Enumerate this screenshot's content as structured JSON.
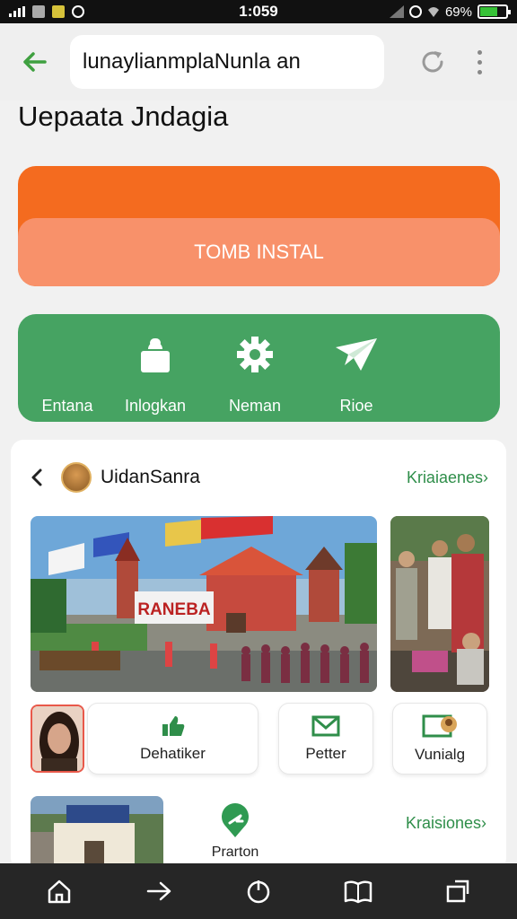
{
  "status_bar": {
    "time": "1:059",
    "battery_text": "69%"
  },
  "browser": {
    "url": "lunaylianmplaNunla an"
  },
  "page": {
    "title": "Uepaata Jndagia",
    "install_button": "TOMB INSTAL",
    "nav_items": [
      {
        "label": "Entana",
        "icon": "home-lock-icon"
      },
      {
        "label": "Inlogkan",
        "icon": "gear-icon"
      },
      {
        "label": "Neman",
        "icon": "gear-icon"
      },
      {
        "label": "Rioe",
        "icon": "send-star-icon"
      }
    ]
  },
  "card": {
    "profile_name": "UidanSanra",
    "link_label": "Kriaiaenes",
    "photo_sign": "RANEBA",
    "actions": [
      {
        "label": "Dehatiker",
        "icon": "thumbs-up-icon"
      },
      {
        "label": "Petter",
        "icon": "mail-icon"
      },
      {
        "label": "Vunialg",
        "icon": "image-person-icon"
      }
    ],
    "pin_label": "Prarton",
    "link2_label": "Kraisiones"
  },
  "colors": {
    "accent_green": "#46a362",
    "accent_orange": "#f46b1f",
    "link_green": "#2f8e4a"
  }
}
